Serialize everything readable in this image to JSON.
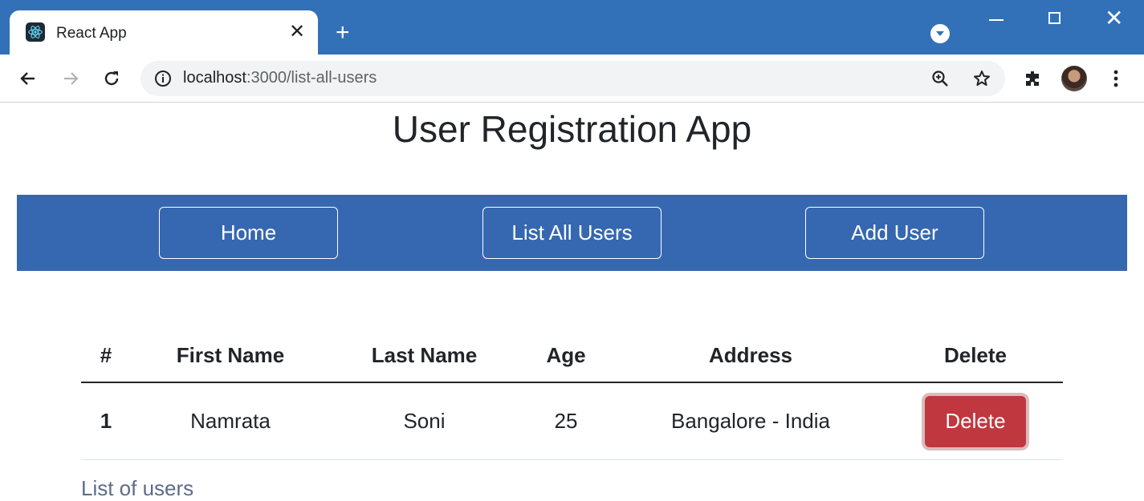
{
  "browser": {
    "tab_title": "React App",
    "url_host": "localhost",
    "url_path": ":3000/list-all-users",
    "accent_color": "#3271b8"
  },
  "page": {
    "title": "User Registration App",
    "nav": [
      {
        "label": "Home"
      },
      {
        "label": "List All Users"
      },
      {
        "label": "Add User"
      }
    ],
    "nav_color": "#3568b0"
  },
  "table": {
    "columns": [
      "#",
      "First Name",
      "Last Name",
      "Age",
      "Address",
      "Delete"
    ],
    "rows": [
      {
        "index": "1",
        "first_name": "Namrata",
        "last_name": "Soni",
        "age": "25",
        "address": "Bangalore - India",
        "action": "Delete"
      }
    ],
    "caption": "List of users",
    "delete_color": "#c0373f"
  }
}
